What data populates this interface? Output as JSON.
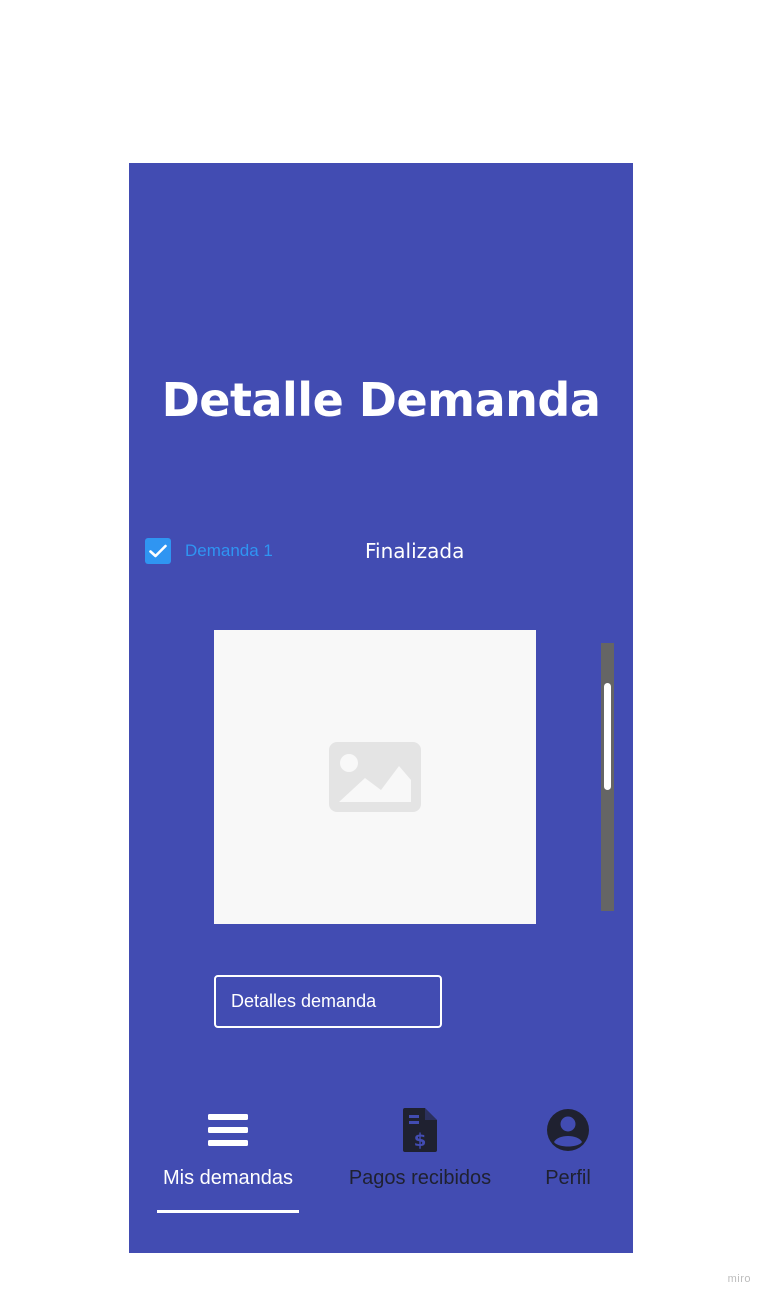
{
  "screen": {
    "title": "Detalle Demanda"
  },
  "demand": {
    "checkbox_label": "Demanda 1",
    "checked": true,
    "status": "Finalizada"
  },
  "image": {
    "icon": "image-placeholder-icon"
  },
  "actions": {
    "details_button_label": "Detalles demanda"
  },
  "bottom_nav": {
    "active_index": 0,
    "items": [
      {
        "label": "Mis demandas",
        "icon": "menu-icon"
      },
      {
        "label": "Pagos recibidos",
        "icon": "invoice-dollar-icon"
      },
      {
        "label": "Perfil",
        "icon": "account-circle-icon"
      }
    ]
  },
  "footer": {
    "watermark": "miro"
  },
  "colors": {
    "background": "#424cb2",
    "accent": "#2f95f2",
    "image_bg": "#f8f8f8",
    "nav_inactive": "#1f2130"
  }
}
